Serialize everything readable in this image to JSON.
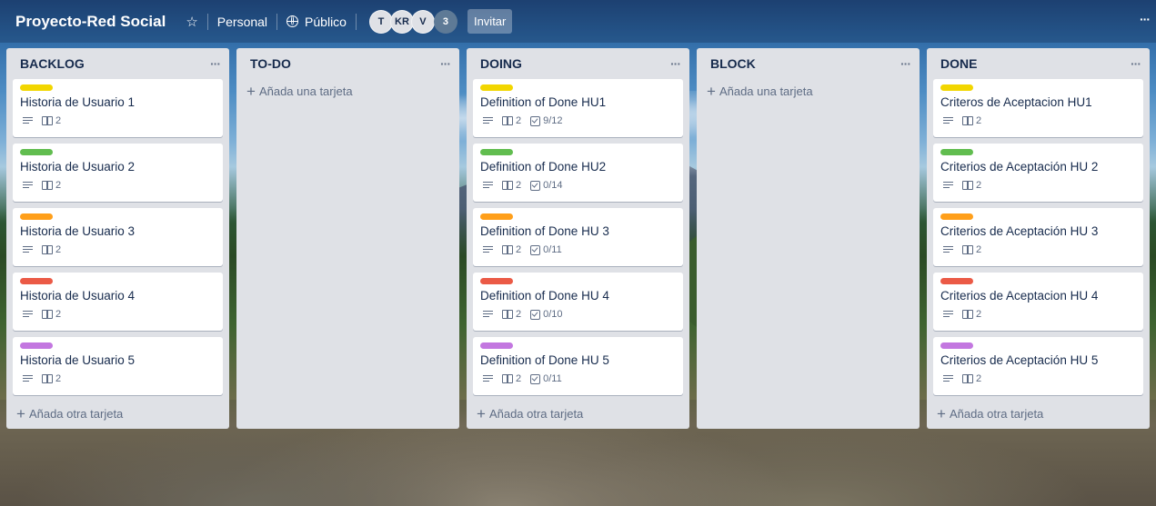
{
  "header": {
    "board_title": "Proyecto-Red Social",
    "star_icon": "☆",
    "personal_label": "Personal",
    "visibility_label": "Público",
    "members": [
      "T",
      "KR",
      "V"
    ],
    "members_more": "3",
    "invite_label": "Invitar",
    "menu_label": "···"
  },
  "label_colors": {
    "yellow": "#f2d600",
    "green": "#61bd4f",
    "orange": "#ff9f1a",
    "red": "#eb5a46",
    "purple": "#c377e0"
  },
  "lists": [
    {
      "title": "BACKLOG",
      "cards": [
        {
          "label": "yellow",
          "title": "Historia de Usuario 1",
          "attachments": "2"
        },
        {
          "label": "green",
          "title": "Historia de Usuario 2",
          "attachments": "2"
        },
        {
          "label": "orange",
          "title": "Historia de Usuario 3",
          "attachments": "2"
        },
        {
          "label": "red",
          "title": "Historia de Usuario 4",
          "attachments": "2"
        },
        {
          "label": "purple",
          "title": "Historia de Usuario 5",
          "attachments": "2"
        }
      ],
      "add_label": "Añada otra tarjeta"
    },
    {
      "title": "TO-DO",
      "cards": [],
      "add_label": "Añada una tarjeta"
    },
    {
      "title": "DOING",
      "cards": [
        {
          "label": "yellow",
          "title": "Definition of Done HU1",
          "attachments": "2",
          "checklist": "9/12"
        },
        {
          "label": "green",
          "title": "Definition of Done HU2",
          "attachments": "2",
          "checklist": "0/14"
        },
        {
          "label": "orange",
          "title": "Definition of Done HU 3",
          "attachments": "2",
          "checklist": "0/11"
        },
        {
          "label": "red",
          "title": "Definition of Done HU 4",
          "attachments": "2",
          "checklist": "0/10"
        },
        {
          "label": "purple",
          "title": "Definition of Done HU 5",
          "attachments": "2",
          "checklist": "0/11"
        }
      ],
      "add_label": "Añada otra tarjeta"
    },
    {
      "title": "BLOCK",
      "cards": [],
      "add_label": "Añada una tarjeta"
    },
    {
      "title": "DONE",
      "cards": [
        {
          "label": "yellow",
          "title": "Criteros de Aceptacion HU1",
          "attachments": "2"
        },
        {
          "label": "green",
          "title": "Criterios de Aceptación HU 2",
          "attachments": "2"
        },
        {
          "label": "orange",
          "title": "Criterios de Aceptación HU 3",
          "attachments": "2"
        },
        {
          "label": "red",
          "title": "Criterios de Aceptacion HU 4",
          "attachments": "2"
        },
        {
          "label": "purple",
          "title": "Criterios de Aceptación HU 5",
          "attachments": "2"
        }
      ],
      "add_label": "Añada otra tarjeta"
    }
  ]
}
